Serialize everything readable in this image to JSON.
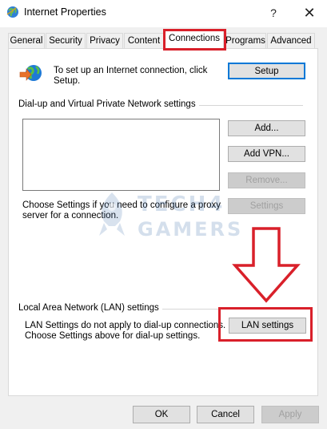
{
  "window": {
    "title": "Internet Properties",
    "help_glyph": "?",
    "close_glyph": "✕"
  },
  "tabs": [
    {
      "label": "General"
    },
    {
      "label": "Security"
    },
    {
      "label": "Privacy"
    },
    {
      "label": "Content"
    },
    {
      "label": "Connections",
      "active": true
    },
    {
      "label": "Programs"
    },
    {
      "label": "Advanced"
    }
  ],
  "setup": {
    "line1": "To set up an Internet connection, click",
    "line2": "Setup.",
    "button_label": "Setup",
    "icon": "internet-connection-icon"
  },
  "dialup": {
    "group_label": "Dial-up and Virtual Private Network settings",
    "add_label": "Add...",
    "add_vpn_label": "Add VPN...",
    "remove_label": "Remove...",
    "settings_label": "Settings",
    "text_line1": "Choose Settings if you need to configure a proxy",
    "text_line2": "server for a connection."
  },
  "watermark": {
    "line1": "TECH4",
    "line2": "GAMERS"
  },
  "lan": {
    "group_label": "Local Area Network (LAN) settings",
    "text_line1": "LAN Settings do not apply to dial-up connections.",
    "text_line2": "Choose Settings above for dial-up settings.",
    "button_label": "LAN settings"
  },
  "footer": {
    "ok_label": "OK",
    "cancel_label": "Cancel",
    "apply_label": "Apply"
  },
  "colors": {
    "highlight": "#d9202a",
    "focus_border": "#0078d7"
  }
}
